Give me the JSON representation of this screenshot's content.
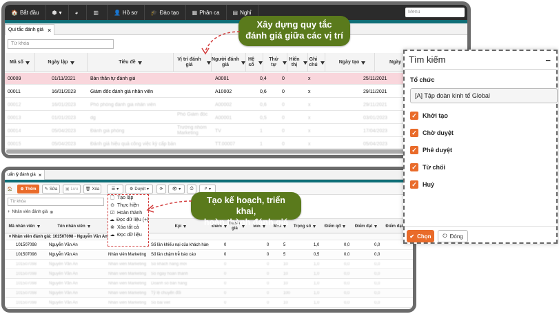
{
  "top_window": {
    "menu": [
      {
        "icon": "home-icon",
        "glyph": "🏠",
        "label": "Bắt đầu"
      },
      {
        "icon": "cube-icon",
        "glyph": "⬢",
        "label": "▾"
      },
      {
        "icon": "dashboard-icon",
        "glyph": "◕",
        "label": ""
      },
      {
        "icon": "chart-icon",
        "glyph": "▥",
        "label": ""
      },
      {
        "icon": "user-icon",
        "glyph": "👤",
        "label": "Hồ sơ"
      },
      {
        "icon": "graduation-icon",
        "glyph": "🎓",
        "label": "Đào tạo"
      },
      {
        "icon": "calendar-icon",
        "glyph": "▦",
        "label": "Phân ca"
      },
      {
        "icon": "leave-icon",
        "glyph": "▤",
        "label": "Nghỉ"
      }
    ],
    "right_search_placeholder": "Menu",
    "tab_label": "Qui tắc đánh giá",
    "search_placeholder": "Từ khóa",
    "columns": [
      "Mã số",
      "Ngày lập",
      "Tiêu đề",
      "Vị trí đánh giá",
      "Người đánh giá",
      "Hệ số",
      "Thứ tự",
      "Hiển thị",
      "Ghi chú",
      "Ngày tạo",
      "Ngày"
    ],
    "rows": [
      {
        "ma": "00009",
        "ngay": "01/11/2021",
        "tieu_de": "Bản thân tự đánh giá",
        "vi_tri": "",
        "nguoi": "A0001",
        "he_so": "0,4",
        "thu_tu": "0",
        "hien_thi": "x",
        "ghi_chu": "",
        "ngay_tao": "25/11/2021",
        "sel": true,
        "blur": false
      },
      {
        "ma": "00011",
        "ngay": "16/01/2023",
        "tieu_de": "Giám đốc đánh giá nhân viên",
        "vi_tri": "",
        "nguoi": "A10002",
        "he_so": "0,6",
        "thu_tu": "0",
        "hien_thi": "x",
        "ghi_chu": "",
        "ngay_tao": "29/11/2021",
        "sel": false,
        "blur": false
      },
      {
        "ma": "00012",
        "ngay": "16/01/2023",
        "tieu_de": "Phó phòng đánh giá nhân viên",
        "vi_tri": "",
        "nguoi": "A00002",
        "he_so": "0,6",
        "thu_tu": "0",
        "hien_thi": "x",
        "ghi_chu": "",
        "ngay_tao": "29/11/2021",
        "sel": false,
        "blur": true
      },
      {
        "ma": "00013",
        "ngay": "01/01/2023",
        "tieu_de": "dg",
        "vi_tri": "Phó Giám đốc",
        "nguoi": "A00001",
        "he_so": "0,5",
        "thu_tu": "0",
        "hien_thi": "x",
        "ghi_chu": "",
        "ngay_tao": "03/01/2023",
        "sel": false,
        "blur": true
      },
      {
        "ma": "00014",
        "ngay": "05/04/2023",
        "tieu_de": "Đánh giá phòng",
        "vi_tri": "Trưởng nhóm Marketing",
        "nguoi": "TV",
        "he_so": "1",
        "thu_tu": "0",
        "hien_thi": "x",
        "ghi_chu": "",
        "ngay_tao": "17/04/2023",
        "sel": false,
        "blur": true
      },
      {
        "ma": "00015",
        "ngay": "05/04/2023",
        "tieu_de": "Đánh giá hiệu quả công việc kỳ cấp bản",
        "vi_tri": "",
        "nguoi": "TT.00007",
        "he_so": "1",
        "thu_tu": "0",
        "hien_thi": "x",
        "ghi_chu": "",
        "ngay_tao": "05/04/2023",
        "sel": false,
        "blur": true
      }
    ]
  },
  "callouts": {
    "top": [
      "Xây dựng quy tắc",
      "đánh giá giữa các vị trí"
    ],
    "bottom": [
      "Tạo kế hoạch, triển khai,",
      "hoàn thành đánh giá"
    ]
  },
  "bottom_window": {
    "tab_label": "uẩn lý đánh giá",
    "toolbar": {
      "add": "Thêm",
      "edit": "Sửa",
      "save": "Lưu",
      "delete": "Xóa",
      "approve": "Duyệt"
    },
    "search_placeholder": "Từ khóa",
    "chip": "Nhân viên đánh giá",
    "columns": [
      "Mã nhân viên",
      "Tên nhân viên",
      "Tên chức danh",
      "Kpi",
      "Điểm",
      "Đánh giá",
      "Min",
      "Max",
      "Trọng số",
      "Điểm qđ",
      "Điểm đạt",
      "Điểm đạt qđ"
    ],
    "group": "Nhân viên đánh giá: 101507098 - Nguyễn Văn An",
    "rows": [
      {
        "ma": "101507098",
        "ten": "Nguyễn Văn An",
        "cd": "Nhân viên Marketing",
        "kpi": "Số lần khiếu nại của khách hàng",
        "diem": "0",
        "min": "0",
        "max": "5",
        "ts": "1,0",
        "qd": "0,0",
        "dat": "0,0",
        "blur": false
      },
      {
        "ma": "101507098",
        "ten": "Nguyễn Văn An",
        "cd": "Nhân viên Marketing",
        "kpi": "Số lần chậm trễ báo cáo",
        "diem": "0",
        "min": "0",
        "max": "5",
        "ts": "0,5",
        "qd": "0,0",
        "dat": "0,0",
        "blur": false
      },
      {
        "ma": "101507098",
        "ten": "Nguyễn Văn An",
        "cd": "Nhân viên Marketing",
        "kpi": "Số khách hàng mới",
        "diem": "0",
        "min": "0",
        "max": "10",
        "ts": "1,0",
        "qd": "0,0",
        "dat": "0,0",
        "blur": true
      },
      {
        "ma": "101507098",
        "ten": "Nguyễn Văn An",
        "cd": "Nhân viên Marketing",
        "kpi": "Số ngày hoàn thành",
        "diem": "0",
        "min": "0",
        "max": "10",
        "ts": "1,0",
        "qd": "0,0",
        "dat": "0,0",
        "blur": true
      },
      {
        "ma": "101507098",
        "ten": "Nguyễn Văn An",
        "cd": "Nhân viên Marketing",
        "kpi": "Doanh số bán hàng",
        "diem": "0",
        "min": "0",
        "max": "10",
        "ts": "1,0",
        "qd": "0,0",
        "dat": "0,0",
        "blur": true
      },
      {
        "ma": "101507098",
        "ten": "Nguyễn Văn An",
        "cd": "Nhân viên Marketing",
        "kpi": "Tỷ lệ chuyển đổi",
        "diem": "0",
        "min": "0",
        "max": "100",
        "ts": "1,0",
        "qd": "0,0",
        "dat": "0,0",
        "blur": true
      },
      {
        "ma": "101507098",
        "ten": "Nguyễn Văn An",
        "cd": "Nhân viên Marketing",
        "kpi": "Số bài viết",
        "diem": "0",
        "min": "0",
        "max": "10",
        "ts": "1,0",
        "qd": "0,0",
        "dat": "0,0",
        "blur": true
      },
      {
        "ma": "101507098",
        "ten": "Nguyễn Văn An",
        "cd": "Nhân viên Marketing",
        "kpi": "Lượt tương tác",
        "diem": "0",
        "min": "0",
        "max": "10",
        "ts": "1,0",
        "qd": "0,0",
        "dat": "0,0",
        "blur": true
      }
    ],
    "menu": [
      {
        "icon": "doc-icon",
        "glyph": "🗋",
        "label": "Tạo lập"
      },
      {
        "icon": "check-circle-icon",
        "glyph": "⊙",
        "label": "Thực hiện"
      },
      {
        "icon": "check-square-icon",
        "glyph": "☑",
        "label": "Hoàn thành"
      },
      {
        "icon": "cloud-download-icon",
        "glyph": "☁",
        "label": "Đọc dữ liệu (+)"
      },
      {
        "icon": "delete-icon",
        "glyph": "⊗",
        "label": "Xóa tất cả"
      },
      {
        "icon": "cloud-download-icon",
        "glyph": "☁",
        "label": "Đọc dữ liệu"
      }
    ]
  },
  "search_panel": {
    "title": "Tìm kiếm",
    "close": "−",
    "org_label": "Tổ chức",
    "org_value": "[A] Tập đoàn kinh tế Global",
    "statuses": [
      "Khởi tạo",
      "Chờ duyệt",
      "Phê duyệt",
      "Từ chối",
      "Huỷ"
    ],
    "ok": "Chọn",
    "close_btn": "Đóng"
  },
  "colors": {
    "accent": "#e96b2a",
    "teal": "#0f6e77",
    "callout": "#5a7a1c",
    "selected_row": "#f9d6dc"
  }
}
